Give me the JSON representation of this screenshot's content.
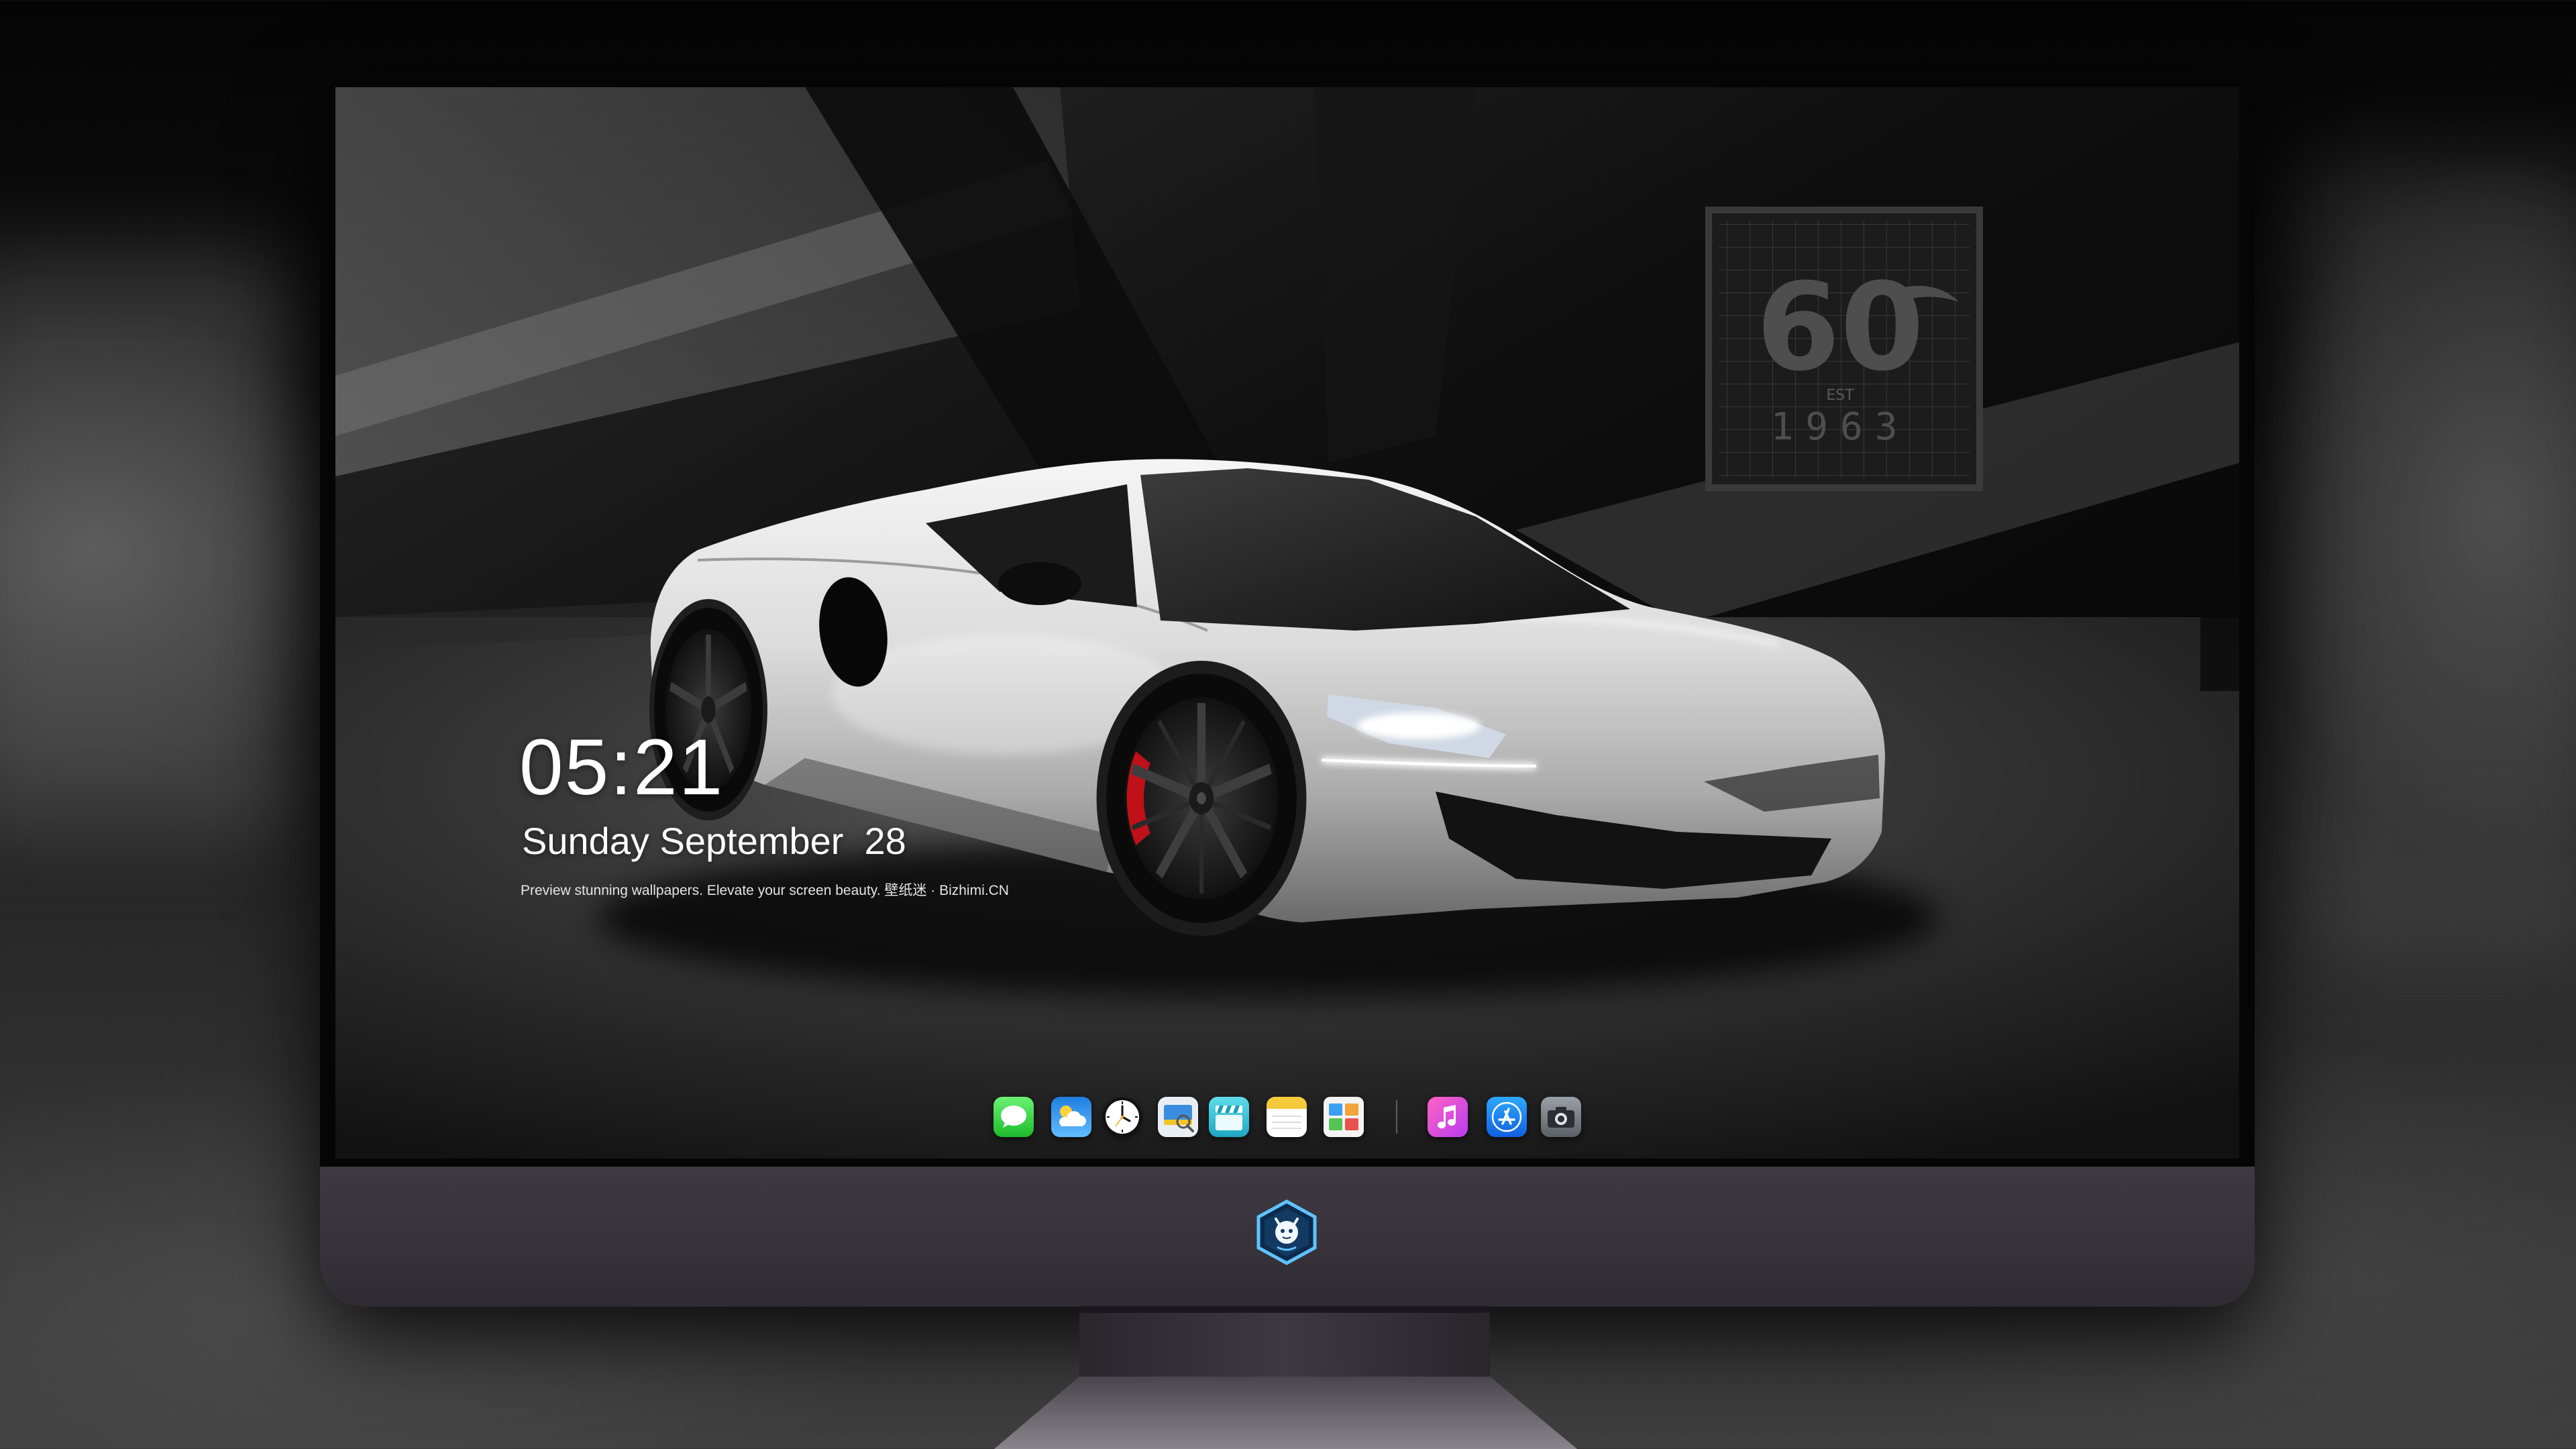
{
  "screen": {
    "time": "05:21",
    "date": "Sunday September  28",
    "tagline": "Preview stunning wallpapers. Elevate your screen beauty. 壁纸迷 · Bizhimi.CN",
    "wallpaper_sign": {
      "number": "60",
      "est": "EST",
      "year": "1963"
    }
  },
  "dock": {
    "apps": [
      "messages-icon",
      "weather-icon",
      "clock-icon",
      "preview-icon",
      "clapperboard-icon",
      "notes-icon",
      "photo-grid-icon"
    ],
    "pinned": [
      "music-icon",
      "app-store-icon",
      "camera-icon"
    ]
  },
  "logo": {
    "icon": "dragon-logo-icon"
  },
  "colors": {
    "screen_text": "#ffffff",
    "monitor_chin": "#3a343c",
    "monitor_bezel": "#050505"
  }
}
